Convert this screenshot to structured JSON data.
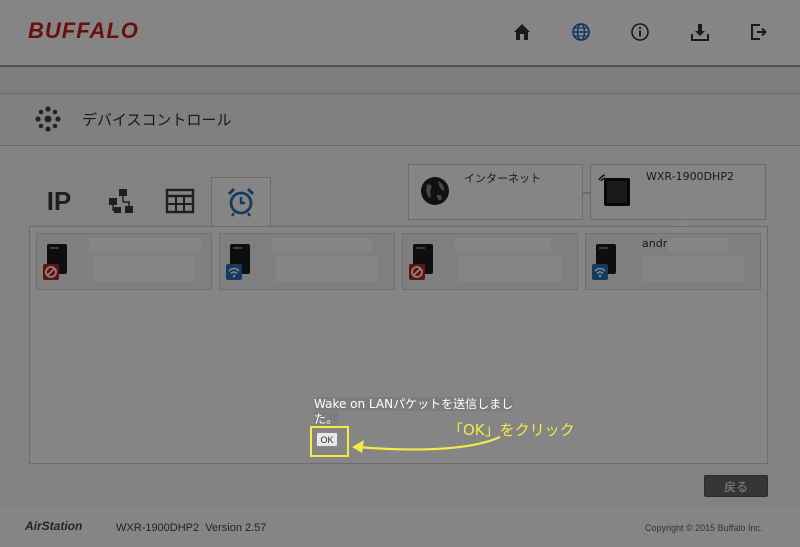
{
  "header": {
    "brand": "BUFFALO",
    "icons": [
      "home-icon",
      "globe-icon",
      "info-icon",
      "download-icon",
      "logout-icon"
    ]
  },
  "title": {
    "text": "デバイスコントロール"
  },
  "tabs": {
    "ip_label": "IP",
    "icons": [
      "network-devices-icon",
      "schedule-grid-icon",
      "alarm-clock-icon"
    ],
    "active": "alarm-clock-icon"
  },
  "network": {
    "internet_label": "インターネット",
    "router_label": "WXR-1900DHP2"
  },
  "devices": [
    {
      "name": "",
      "status": "blocked"
    },
    {
      "name": "",
      "status": "wifi"
    },
    {
      "name": "",
      "status": "blocked"
    },
    {
      "name": "andr",
      "status": "wifi"
    }
  ],
  "back_button": "戻る",
  "footer": {
    "brand": "AirStation",
    "model": "WXR-1900DHP2",
    "version": "Version 2.57",
    "copyright": "Copyright © 2015 Buffalo Inc."
  },
  "dialog": {
    "line1": "Wake on LANパケットを送信しまし",
    "line2": "た。",
    "ok_label": "OK"
  },
  "annotation": {
    "text": "「OK」をクリック",
    "color": "#f2ea45"
  },
  "colors": {
    "brand_red": "#d01e1e",
    "accent_blue": "#2a6fb8"
  }
}
